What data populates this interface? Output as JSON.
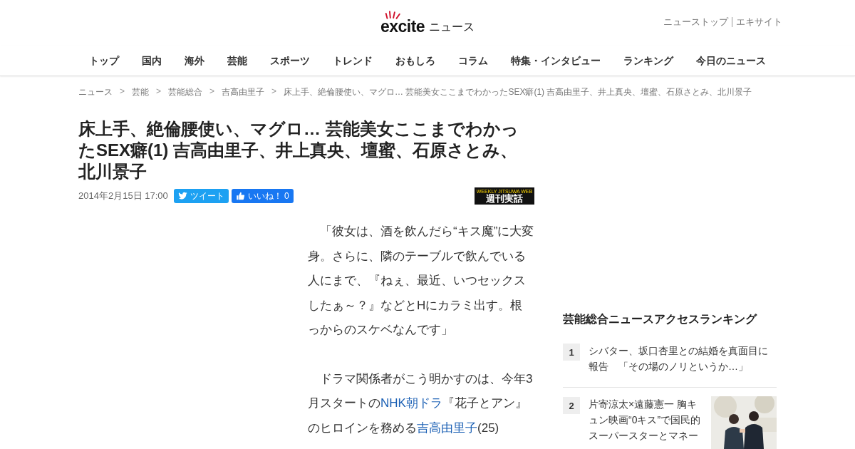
{
  "header": {
    "logo": {
      "brand": "excite",
      "section": "ニュース"
    },
    "links": [
      "ニューストップ",
      "エキサイト"
    ]
  },
  "nav": [
    {
      "label": "トップ",
      "selected": false
    },
    {
      "label": "国内",
      "selected": false
    },
    {
      "label": "海外",
      "selected": false
    },
    {
      "label": "芸能",
      "selected": false
    },
    {
      "label": "スポーツ",
      "selected": false
    },
    {
      "label": "トレンド",
      "selected": false
    },
    {
      "label": "おもしろ",
      "selected": false
    },
    {
      "label": "コラム",
      "selected": false
    },
    {
      "label": "特集・インタビュー",
      "selected": false
    },
    {
      "label": "ランキング",
      "selected": false
    },
    {
      "label": "今日のニュース",
      "selected": false
    }
  ],
  "breadcrumb": {
    "separator": ">",
    "items": [
      "ニュース",
      "芸能",
      "芸能総合",
      "吉高由里子",
      "床上手、絶倫腰使い、マグロ… 芸能美女ここまでわかったSEX癖(1) 吉高由里子、井上真央、壇蜜、石原さとみ、北川景子"
    ]
  },
  "article": {
    "title": "床上手、絶倫腰使い、マグロ… 芸能美女ここまでわかったSEX癖(1) 吉高由里子、井上真央、壇蜜、石原さとみ、北川景子",
    "date": "2014年2月15日 17:00",
    "tweet": "ツイート",
    "like": {
      "label": "いいね！",
      "count": "0"
    },
    "publisher": {
      "small": "WEEKLY JITSUWA WEB",
      "name": "週刊実話"
    },
    "paragraphs": [
      [
        {
          "text": "「彼女は、酒を飲んだら“キス魔”に大変身。さらに、隣のテーブルで飲んでいる人にまで、『ねぇ、最近、いつセックスしたぁ～？』などとHにカラミ出す。根っからのスケベなんです」",
          "kind": "text"
        }
      ],
      [
        {
          "text": "ドラマ関係者がこう明かすのは、今年3月スタートの",
          "kind": "text"
        },
        {
          "text": "NHK朝ドラ",
          "kind": "link"
        },
        {
          "text": "『花子とアン』のヒロインを務める",
          "kind": "text"
        },
        {
          "text": "吉高由里子",
          "kind": "link"
        },
        {
          "text": "(25)",
          "kind": "text"
        }
      ]
    ]
  },
  "ranking": {
    "title": "芸能総合ニュースアクセスランキング",
    "items": [
      {
        "rank": "1",
        "text": "シバター、坂口杏里との結婚を真面目に報告　「その場のノリというか…」"
      },
      {
        "rank": "2",
        "text": "片寄涼太×遠藤憲一 胸キュン映画“0キス”で国民的スーパースターとマネー",
        "kind": "picture"
      }
    ]
  }
}
